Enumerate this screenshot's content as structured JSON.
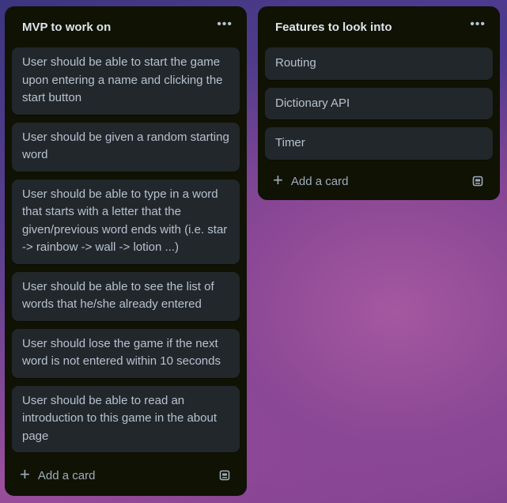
{
  "lists": [
    {
      "title": "MVP to work on",
      "menu_glyph": "•••",
      "cards": [
        "User should be able to start the game upon entering a name and clicking the start button",
        "User should be given a random starting word",
        "User should be able to type in a word that starts with a letter that the given/previous word ends with (i.e. star -> rainbow -> wall -> lotion ...)",
        "User should be able to see the list of words that he/she already entered",
        "User should lose the game if the next word is not entered within 10 seconds",
        "User should be able to read an introduction to this game in the about page"
      ],
      "add_card_label": "Add a card"
    },
    {
      "title": "Features to look into",
      "menu_glyph": "•••",
      "cards": [
        "Routing",
        "Dictionary API",
        "Timer"
      ],
      "add_card_label": "Add a card"
    }
  ],
  "icons": {
    "menu": "more-horizontal-icon",
    "add": "plus-icon",
    "template": "card-template-icon"
  },
  "colors": {
    "list_bg": "#101204",
    "card_bg": "#22272b",
    "text": "#b6c2cf"
  }
}
